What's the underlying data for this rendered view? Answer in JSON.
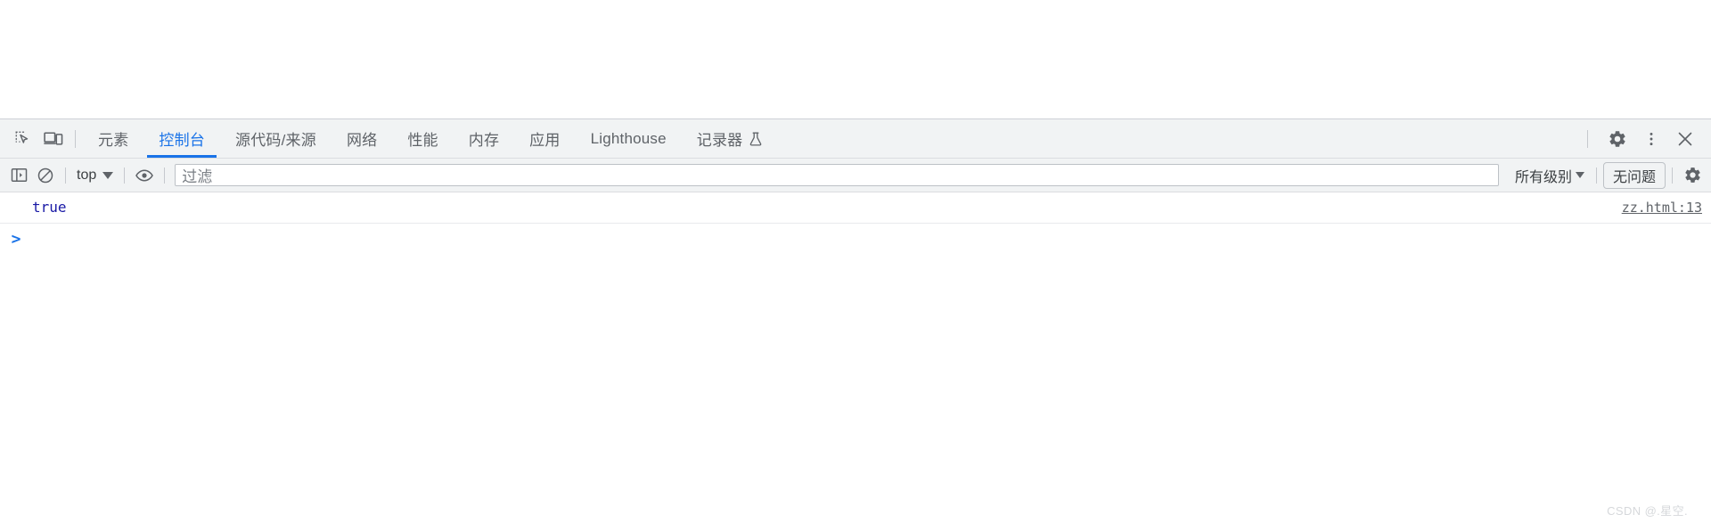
{
  "window": {
    "page_area_background": "#ffffff"
  },
  "devtools": {
    "toolbar": {
      "inspect_icon": "inspect-element-icon",
      "device_icon": "device-toolbar-icon",
      "tabs": [
        {
          "id": "elements",
          "label": "元素",
          "active": false
        },
        {
          "id": "console",
          "label": "控制台",
          "active": true
        },
        {
          "id": "sources",
          "label": "源代码/来源",
          "active": false
        },
        {
          "id": "network",
          "label": "网络",
          "active": false
        },
        {
          "id": "performance",
          "label": "性能",
          "active": false
        },
        {
          "id": "memory",
          "label": "内存",
          "active": false
        },
        {
          "id": "application",
          "label": "应用",
          "active": false
        },
        {
          "id": "lighthouse",
          "label": "Lighthouse",
          "active": false
        },
        {
          "id": "recorder",
          "label": "记录器",
          "active": false,
          "icon": "flask-icon"
        }
      ],
      "settings_icon": "gear-icon",
      "more_icon": "kebab-menu-icon",
      "close_icon": "close-icon",
      "active_tab_color": "#1a73e8",
      "background": "#f1f3f4"
    },
    "console_toolbar": {
      "sidebar_toggle_icon": "console-sidebar-icon",
      "clear_icon": "clear-console-icon",
      "context": {
        "value": "top",
        "caret_icon": "chevron-down-icon"
      },
      "eye_icon": "live-expression-icon",
      "filter": {
        "value": "",
        "placeholder": "过滤"
      },
      "levels": {
        "value": "所有级别",
        "caret_icon": "chevron-down-icon"
      },
      "issues_label": "无问题",
      "settings_icon": "gear-icon"
    },
    "console": {
      "messages": [
        {
          "text": "true",
          "color": "#1a1aa6",
          "source": "zz.html:13"
        }
      ],
      "prompt": {
        "arrow": ">",
        "value": ""
      }
    }
  },
  "watermark": {
    "text": "CSDN @.星空.",
    "color": "#d6d8db"
  }
}
